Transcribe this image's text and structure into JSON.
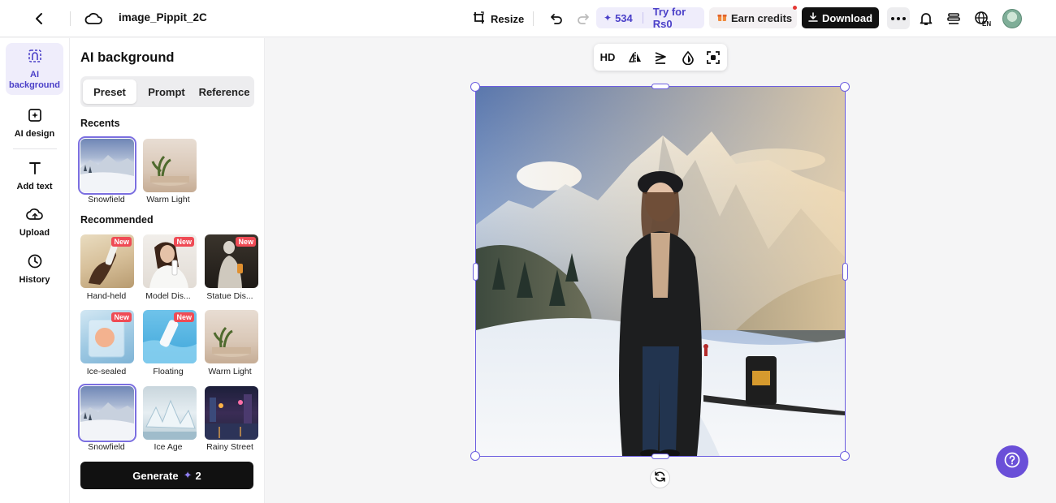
{
  "header": {
    "file_name": "image_Pippit_2C",
    "resize_label": "Resize",
    "credits_count": "534",
    "try_label": "Try for Rs0",
    "earn_label": "Earn credits",
    "download_label": "Download",
    "language_code": "EN"
  },
  "rail": {
    "items": [
      {
        "label": "AI background",
        "icon": "ai-background-icon"
      },
      {
        "label": "AI design",
        "icon": "ai-design-icon"
      },
      {
        "label": "Add text",
        "icon": "text-icon"
      },
      {
        "label": "Upload",
        "icon": "upload-cloud-icon"
      },
      {
        "label": "History",
        "icon": "clock-icon"
      }
    ]
  },
  "panel": {
    "title": "AI background",
    "tabs": [
      "Preset",
      "Prompt",
      "Reference"
    ],
    "active_tab": "Preset",
    "recents_title": "Recents",
    "recents": [
      {
        "label": "Snowfield",
        "selected": true
      },
      {
        "label": "Warm Light",
        "selected": false
      }
    ],
    "recommended_title": "Recommended",
    "recommended": [
      {
        "label": "Hand-held",
        "badge": "New"
      },
      {
        "label": "Model Dis...",
        "badge": "New"
      },
      {
        "label": "Statue Dis...",
        "badge": "New"
      },
      {
        "label": "Ice-sealed",
        "badge": "New"
      },
      {
        "label": "Floating",
        "badge": "New"
      },
      {
        "label": "Warm Light",
        "badge": ""
      },
      {
        "label": "Snowfield",
        "badge": ""
      },
      {
        "label": "Ice Age",
        "badge": ""
      },
      {
        "label": "Rainy Street",
        "badge": ""
      }
    ],
    "generate_label": "Generate",
    "generate_cost": "2"
  },
  "toolbar": {
    "hd_label": "HD"
  },
  "colors": {
    "accent": "#6c5ee0",
    "accent_bg": "#efedfb",
    "badge_red": "#ef4b55",
    "dark_button": "#111111",
    "help_button": "#6a4fd8"
  }
}
